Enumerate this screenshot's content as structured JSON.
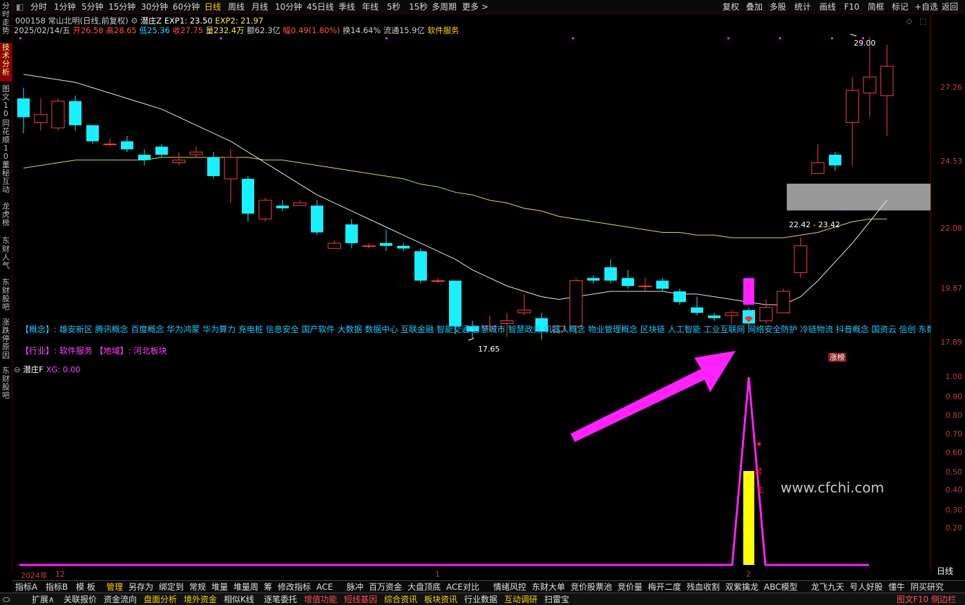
{
  "topbar": {
    "items": [
      "分时",
      "1分钟",
      "5分钟",
      "15分钟",
      "30分钟",
      "60分钟",
      "日线",
      "周线",
      "月线",
      "10分钟",
      "45日线",
      "季线",
      "年线",
      "5秒",
      "15秒",
      "多周期",
      "更多 >"
    ],
    "right": [
      "复权",
      "叠加",
      "多股",
      "统计",
      "画线",
      "F10",
      "简框",
      "标记",
      "+自选",
      "返回"
    ]
  },
  "sidebar": {
    "tabs": [
      "分时走势",
      "技术分析",
      "图文10",
      "同花顺10",
      "董秘互动",
      "龙虎榜",
      "东财人气",
      "东财股吧",
      "涨跌停原因",
      "东财股吧"
    ]
  },
  "stock": {
    "line1": "000158 常山北明(日线,前复权)",
    "indicator": "潜庄Z",
    "exp1": "EXP1: 23.50",
    "exp2": "EXP2: 21.97",
    "date": "2025/02/14/五",
    "open": "开26.58",
    "high": "高28.65",
    "low": "低25.36",
    "close": "收27.75",
    "vol": "量232.4万",
    "amt": "额62.3亿",
    "chg": "幅0.49(1.80%)",
    "turn": "换14.64%",
    "float": "流通15.9亿",
    "sector": "软件服务"
  },
  "axis_labels": [
    "27.26",
    "24.53",
    "22.08",
    "19.87",
    "17.89"
  ],
  "sub_axis": [
    "1.00",
    "0.90",
    "0.80",
    "0.70",
    "0.60",
    "0.50",
    "0.40",
    "0.30",
    "0.20"
  ],
  "annotations": {
    "high": "29.00",
    "low": "17.65",
    "zone": "22.42 - 23.42",
    "limit_up": "涨榜",
    "zhu": "主",
    "qian": "潜"
  },
  "concept": "【概念】: 雄安新区 腾讯概念 百度概念 华为鸿蒙 华为算力 充电桩 信息安全 国产软件 大数据 数据中心 互联金融 智能交通 智慧城市 智慧政务 机器人概念 物业管理概念 区块链 人工智能 工业互联网 网络安全防护 冷链物流 抖音概念 国资云 信创 东数西算 数据",
  "industry": "【行业】:  软件服务 【地域】: 河北板块",
  "subchart": {
    "name": "潜庄F",
    "xg": "XG: 0.00"
  },
  "dates": {
    "y2024": "2024年",
    "m12": "12",
    "m1": "1",
    "m2": "2",
    "period": "日线"
  },
  "watermark": "www.cfchi.com",
  "bottom1": [
    "指标A",
    "指标B",
    "模 板",
    "管理",
    "另存为",
    "绑定到",
    "常规",
    "堆量",
    "堆量周",
    "筹",
    "修改指标",
    "ACE",
    "脉冲",
    "百万资金",
    "大盘顶底",
    "ACE对比",
    "情绪风控",
    "东财大单",
    "竞价股票池",
    "竞价量",
    "梅开二度",
    "残血收割",
    "双紫擒龙",
    "ABC模型",
    "龙飞九天",
    "号人好股",
    "懂牛",
    "阴买研究",
    ">",
    "+",
    "-"
  ],
  "bottom2": [
    {
      "t": "扩展∧",
      "c": "#e0e0e0"
    },
    {
      "t": "关联报价",
      "c": "#e0e0e0"
    },
    {
      "t": "资金流向",
      "c": "#e0e0e0"
    },
    {
      "t": "盘面分析",
      "c": "#ffd400"
    },
    {
      "t": "境外资金",
      "c": "#ffd400"
    },
    {
      "t": "相似K线",
      "c": "#e0e0e0"
    },
    {
      "t": "逐笔委托",
      "c": "#e0e0e0"
    },
    {
      "t": "增值功能",
      "c": "#ff5050"
    },
    {
      "t": "短线基因",
      "c": "#ff5050"
    },
    {
      "t": "综合资讯",
      "c": "#ffd400"
    },
    {
      "t": "板块资讯",
      "c": "#ffd400"
    },
    {
      "t": "行业数据",
      "c": "#e0e0e0"
    },
    {
      "t": "互动调研",
      "c": "#ffd400"
    },
    {
      "t": "扫雷宝",
      "c": "#e0e0e0"
    },
    {
      "t": "图文F10 侧边栏",
      "c": "#ff5050"
    }
  ],
  "chart_data": {
    "type": "candlestick",
    "ylim": [
      17.0,
      29.5
    ],
    "candles": [
      [
        26.6,
        25.9,
        27.0,
        25.3
      ],
      [
        25.7,
        26.0,
        26.6,
        25.4
      ],
      [
        25.5,
        26.5,
        26.6,
        25.4
      ],
      [
        26.5,
        25.6,
        26.7,
        25.4
      ],
      [
        25.6,
        25.0,
        25.6,
        24.9
      ],
      [
        24.9,
        24.9,
        25.1,
        24.8
      ],
      [
        25.0,
        24.7,
        25.2,
        24.6
      ],
      [
        24.5,
        24.3,
        24.7,
        24.1
      ],
      [
        24.8,
        24.5,
        24.9,
        24.4
      ],
      [
        24.2,
        24.3,
        24.6,
        24.1
      ],
      [
        24.5,
        24.6,
        24.8,
        24.4
      ],
      [
        24.4,
        23.7,
        24.6,
        23.6
      ],
      [
        23.6,
        24.4,
        24.7,
        22.7
      ],
      [
        23.6,
        22.3,
        23.7,
        22.0
      ],
      [
        22.1,
        22.8,
        22.9,
        22.0
      ],
      [
        22.6,
        22.5,
        22.8,
        22.4
      ],
      [
        22.6,
        22.7,
        22.8,
        22.6
      ],
      [
        22.6,
        21.6,
        22.8,
        21.5
      ],
      [
        21.0,
        21.2,
        21.3,
        21.1
      ],
      [
        21.9,
        21.2,
        22.1,
        21.0
      ],
      [
        21.1,
        21.1,
        21.2,
        21.0
      ],
      [
        21.2,
        21.1,
        21.7,
        20.9
      ],
      [
        21.1,
        21.0,
        21.2,
        20.9
      ],
      [
        20.9,
        19.8,
        21.0,
        19.7
      ],
      [
        19.8,
        19.8,
        19.9,
        19.7
      ],
      [
        19.8,
        18.1,
        19.8,
        17.8
      ],
      [
        18.1,
        17.9,
        18.3,
        17.65
      ],
      [
        18.0,
        18.1,
        18.5,
        17.9
      ],
      [
        18.2,
        18.3,
        18.6,
        17.7
      ],
      [
        18.6,
        18.7,
        19.3,
        18.5
      ],
      [
        18.4,
        17.9,
        18.6,
        17.6
      ],
      [
        17.9,
        18.1,
        18.1,
        17.8
      ],
      [
        18.1,
        19.8,
        19.9,
        17.8
      ],
      [
        19.9,
        19.8,
        20.0,
        19.7
      ],
      [
        20.3,
        19.8,
        20.6,
        19.7
      ],
      [
        19.9,
        19.6,
        20.2,
        19.5
      ],
      [
        19.6,
        19.6,
        19.9,
        19.4
      ],
      [
        19.8,
        19.5,
        19.9,
        19.4
      ],
      [
        19.4,
        19.0,
        19.5,
        18.9
      ],
      [
        18.8,
        18.6,
        19.2,
        18.5
      ],
      [
        18.5,
        18.4,
        18.6,
        18.3
      ],
      [
        18.5,
        18.6,
        18.7,
        18.2
      ],
      [
        18.7,
        18.2,
        18.8,
        18.1
      ],
      [
        18.3,
        18.8,
        19.1,
        18.2
      ],
      [
        18.6,
        19.4,
        19.5,
        18.6
      ],
      [
        20.1,
        21.1,
        21.4,
        19.9
      ],
      [
        23.8,
        24.2,
        24.9,
        23.8
      ],
      [
        24.5,
        24.1,
        24.6,
        23.9
      ],
      [
        25.7,
        26.9,
        27.4,
        24.1
      ],
      [
        26.8,
        27.4,
        28.9,
        25.9
      ],
      [
        26.7,
        27.8,
        28.6,
        25.2
      ]
    ],
    "ma_white": [
      27.5,
      27.4,
      27.3,
      27.2,
      27.0,
      26.8,
      26.6,
      26.4,
      26.2,
      25.9,
      25.6,
      25.3,
      25.0,
      24.6,
      24.2,
      23.8,
      23.4,
      23.0,
      22.7,
      22.4,
      22.1,
      21.8,
      21.5,
      21.2,
      20.9,
      20.6,
      20.2,
      19.9,
      19.6,
      19.4,
      19.2,
      19.1,
      19.2,
      19.3,
      19.4,
      19.4,
      19.4,
      19.4,
      19.3,
      19.3,
      19.2,
      19.1,
      19.0,
      18.9,
      18.9,
      19.2,
      19.8,
      20.5,
      21.2,
      22.0,
      22.8
    ],
    "ma_yellow": [
      24.0,
      24.1,
      24.2,
      24.3,
      24.3,
      24.3,
      24.3,
      24.3,
      24.4,
      24.4,
      24.4,
      24.4,
      24.4,
      24.4,
      24.3,
      24.3,
      24.2,
      24.1,
      24.0,
      23.9,
      23.8,
      23.7,
      23.6,
      23.4,
      23.3,
      23.1,
      23.0,
      22.8,
      22.7,
      22.5,
      22.4,
      22.2,
      22.1,
      22.0,
      21.9,
      21.8,
      21.7,
      21.6,
      21.6,
      21.5,
      21.5,
      21.4,
      21.4,
      21.4,
      21.4,
      21.5,
      21.6,
      21.8,
      22.0,
      22.1,
      22.1
    ],
    "sub_signal": {
      "peak_index": 42,
      "peak": 1.0,
      "bar": 0.5
    }
  }
}
